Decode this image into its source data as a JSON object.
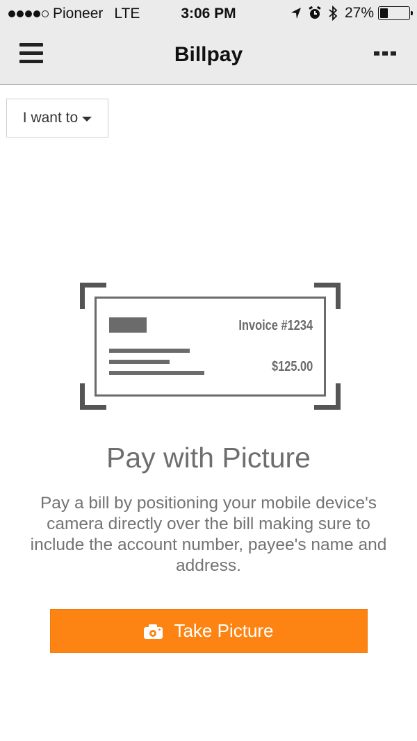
{
  "status_bar": {
    "signal_bars_filled": 4,
    "signal_bars_total": 5,
    "carrier": "Pioneer",
    "network": "LTE",
    "time": "3:06 PM",
    "icons": [
      "location-arrow-icon",
      "alarm-icon",
      "bluetooth-icon"
    ],
    "battery_percent_label": "27%",
    "battery_level": 0.27
  },
  "nav": {
    "title": "Billpay",
    "menu_icon": "hamburger-icon",
    "more_icon": "more-dots-icon"
  },
  "action_menu": {
    "label": "I want to",
    "icon": "caret-down-icon"
  },
  "illustration": {
    "invoice_number": "Invoice #1234",
    "amount": "$125.00"
  },
  "main": {
    "headline": "Pay with Picture",
    "description": "Pay a bill by positioning your mobile device's camera directly over the bill making sure to include the account number, payee's name and address."
  },
  "take_picture_button": {
    "label": "Take Picture",
    "icon": "camera-icon",
    "color": "#fd8412"
  }
}
